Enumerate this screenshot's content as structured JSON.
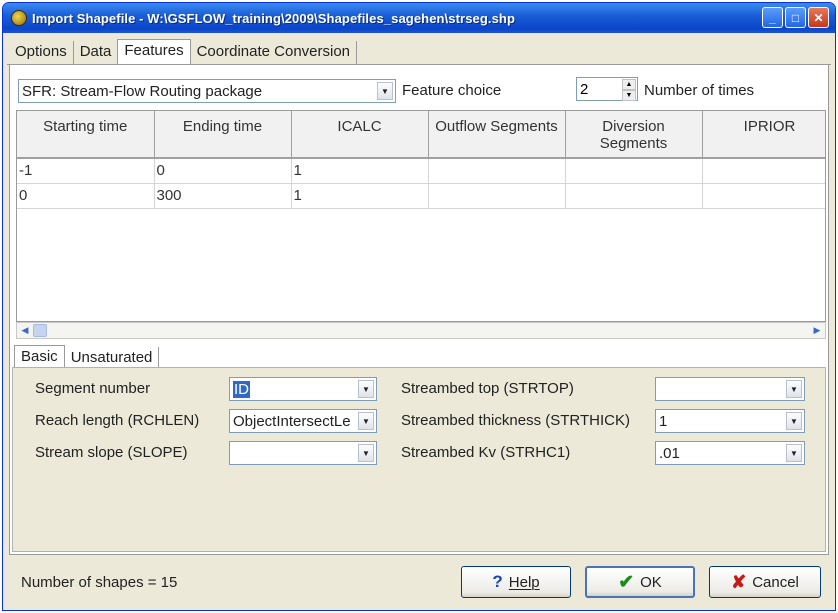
{
  "window": {
    "title": "Import Shapefile - W:\\GSFLOW_training\\2009\\Shapefiles_sagehen\\strseg.shp",
    "minimize_glyph": "_",
    "maximize_glyph": "□",
    "close_glyph": "✕"
  },
  "tabs": [
    {
      "label": "Options"
    },
    {
      "label": "Data"
    },
    {
      "label": "Features"
    },
    {
      "label": "Coordinate Conversion"
    }
  ],
  "feature": {
    "package_value": "SFR: Stream-Flow Routing package",
    "feature_choice_label": "Feature choice",
    "times_value": "2",
    "times_label": "Number of times"
  },
  "grid": {
    "columns": [
      "Starting time",
      "Ending time",
      "ICALC",
      "Outflow Segments",
      "Diversion Segments",
      "IPRIOR"
    ],
    "rows": [
      [
        "-1",
        "0",
        "1",
        "",
        "",
        ""
      ],
      [
        "0",
        "300",
        "1",
        "",
        "",
        ""
      ]
    ]
  },
  "subtabs": [
    {
      "label": "Basic"
    },
    {
      "label": "Unsaturated"
    }
  ],
  "basic": {
    "segment_number": {
      "label": "Segment number",
      "value": "ID"
    },
    "reach_length": {
      "label": "Reach length (RCHLEN)",
      "value": "ObjectIntersectLe"
    },
    "stream_slope": {
      "label": "Stream slope (SLOPE)",
      "value": ""
    },
    "streambed_top": {
      "label": "Streambed top (STRTOP)",
      "value": ""
    },
    "streambed_thickness": {
      "label": "Streambed thickness (STRTHICK)",
      "value": "1"
    },
    "streambed_kv": {
      "label": "Streambed Kv (STRHC1)",
      "value": ".01"
    }
  },
  "status": {
    "shapes_text": "Number of shapes = 15"
  },
  "buttons": {
    "help": "Help",
    "ok": "OK",
    "cancel": "Cancel"
  },
  "icons": {
    "dropdown_arrow": "▼",
    "spin_up": "▲",
    "spin_down": "▼",
    "scroll_left": "◀",
    "scroll_right": "▶",
    "help": "?",
    "ok": "✔",
    "cancel": "✘"
  },
  "colors": {
    "titlebar": "#0a45c8",
    "dialog_bg": "#ece9d8",
    "field_border": "#7f9db9",
    "ok_check": "#1b8c1b",
    "cancel_x": "#c61a1a"
  }
}
